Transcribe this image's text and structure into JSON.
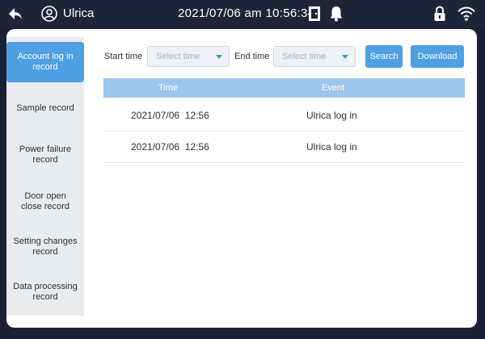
{
  "topbar": {
    "username": "Ulrica",
    "datetime": "2021/07/06 am 10:56:34"
  },
  "sidebar": {
    "items": [
      {
        "label": "Account log in record",
        "active": true
      },
      {
        "label": "Sample record",
        "active": false
      },
      {
        "label": "Power failure record",
        "active": false
      },
      {
        "label": "Door open close record",
        "active": false
      },
      {
        "label": "Setting changes record",
        "active": false
      },
      {
        "label": "Data processing record",
        "active": false
      }
    ]
  },
  "filters": {
    "start_label": "Start time",
    "start_placeholder": "Select time",
    "end_label": "End time",
    "end_placeholder": "Select time",
    "search_label": "Search",
    "download_label": "Download"
  },
  "table": {
    "headers": [
      "Time",
      "Event"
    ],
    "rows": [
      {
        "time": "2021/07/06  12:56",
        "event": "Ulrica log in"
      },
      {
        "time": "2021/07/06  12:56",
        "event": "Ulrica log in"
      }
    ]
  },
  "colors": {
    "accent": "#4fa0e3",
    "header": "#9cc6ec",
    "topbar": "#1f2538"
  },
  "icons": [
    "back-arrow-icon",
    "user-icon",
    "door-icon",
    "bell-icon",
    "lock-icon",
    "wifi-icon"
  ]
}
